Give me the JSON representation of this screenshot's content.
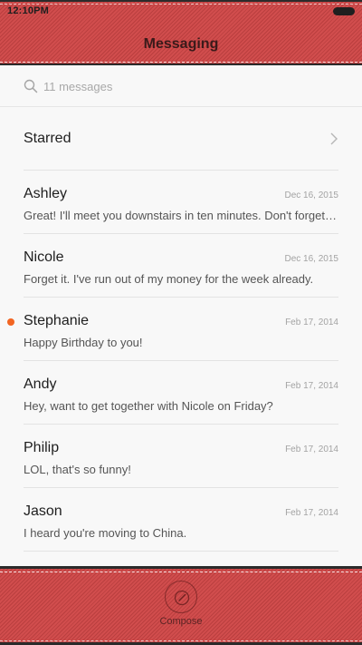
{
  "status_bar": {
    "time": "12:10PM"
  },
  "header": {
    "title": "Messaging"
  },
  "search": {
    "placeholder": "11 messages"
  },
  "starred": {
    "label": "Starred"
  },
  "conversations": [
    {
      "name": "Ashley",
      "date": "Dec 16, 2015",
      "preview": "Great! I'll meet you downstairs in ten minutes. Don't forget your umbrella.",
      "unread": false
    },
    {
      "name": "Nicole",
      "date": "Dec 16, 2015",
      "preview": "Forget it. I've run out of my money for the week already.",
      "unread": false
    },
    {
      "name": "Stephanie",
      "date": "Feb 17, 2014",
      "preview": "Happy Birthday to you!",
      "unread": true
    },
    {
      "name": "Andy",
      "date": "Feb 17, 2014",
      "preview": "Hey, want to get together with Nicole on Friday?",
      "unread": false
    },
    {
      "name": "Philip",
      "date": "Feb 17, 2014",
      "preview": "LOL, that's so funny!",
      "unread": false
    },
    {
      "name": "Jason",
      "date": "Feb 17, 2014",
      "preview": "I heard you're moving to China.",
      "unread": false
    }
  ],
  "footer": {
    "compose_label": "Compose"
  },
  "colors": {
    "accent_red": "#cf4646",
    "unread_dot": "#f26522"
  },
  "icons": {
    "search": "search-icon",
    "chevron": "chevron-right-icon",
    "compose": "compose-icon",
    "battery": "battery-icon"
  }
}
